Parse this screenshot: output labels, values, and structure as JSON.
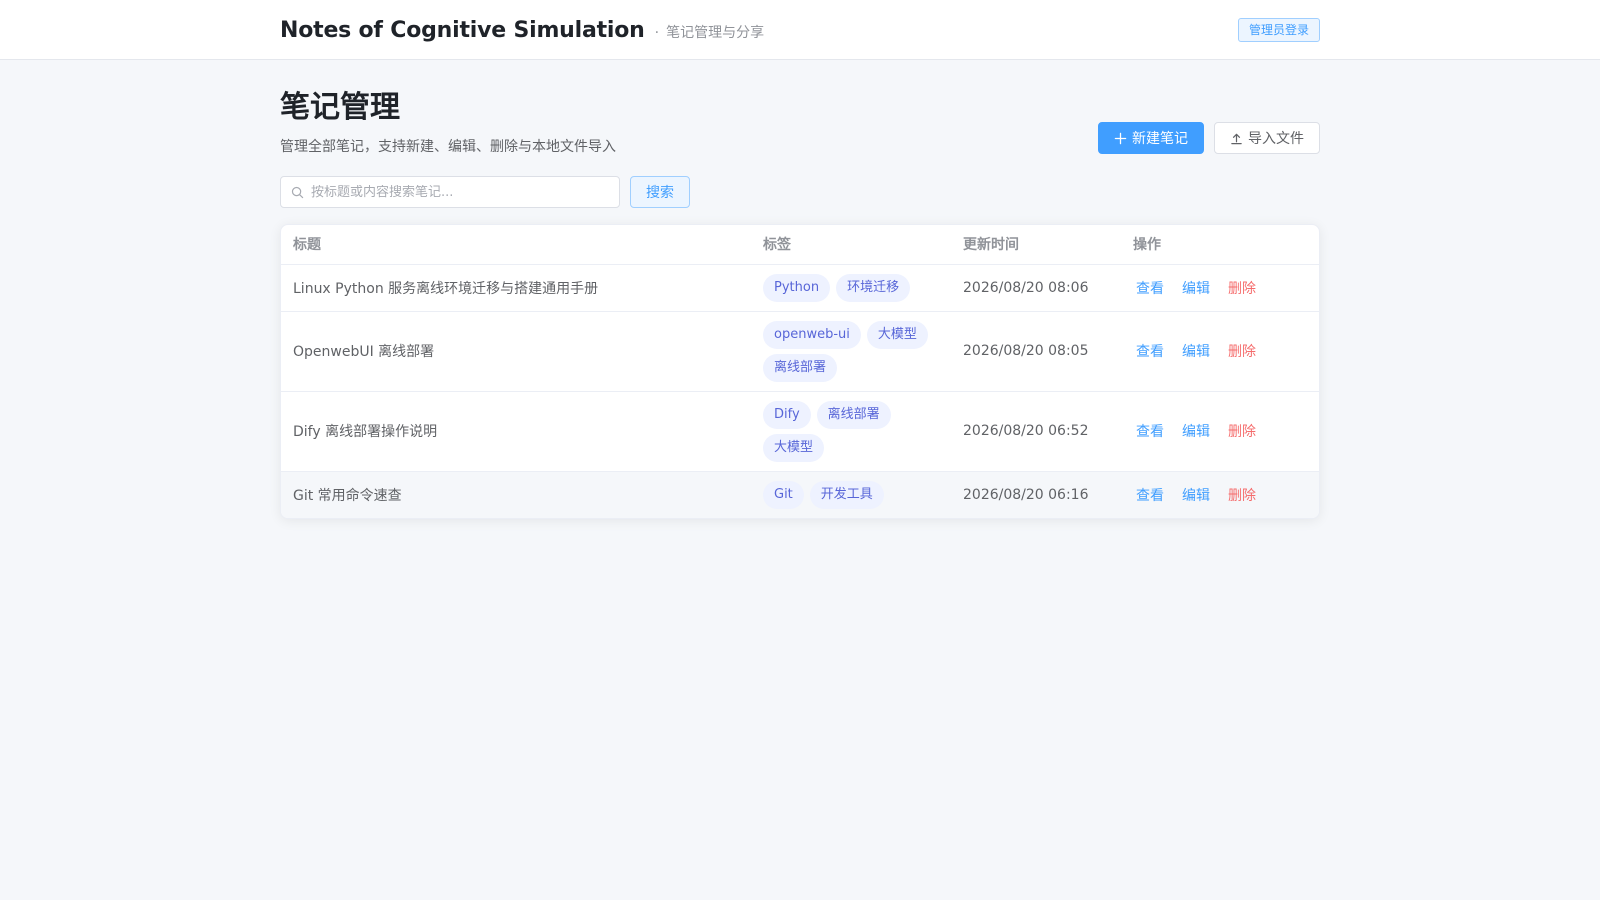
{
  "header": {
    "brand_title": "Notes of Cognitive Simulation",
    "separator": "·",
    "brand_subtitle": "笔记管理与分享",
    "admin_login_label": "管理员登录"
  },
  "page": {
    "title": "笔记管理",
    "description": "管理全部笔记，支持新建、编辑、删除与本地文件导入",
    "new_note_label": "新建笔记",
    "import_label": "导入文件"
  },
  "search": {
    "placeholder": "按标题或内容搜索笔记...",
    "value": "",
    "button_label": "搜索"
  },
  "table": {
    "columns": [
      "标题",
      "标签",
      "更新时间",
      "操作"
    ],
    "rows": [
      {
        "title": "Linux Python 服务离线环境迁移与搭建通用手册",
        "tags": [
          "Python",
          "环境迁移"
        ],
        "updated": "2026/08/20 08:06"
      },
      {
        "title": "OpenwebUI 离线部署",
        "tags": [
          "openweb-ui",
          "大模型",
          "离线部署"
        ],
        "updated": "2026/08/20 08:05"
      },
      {
        "title": "Dify 离线部署操作说明",
        "tags": [
          "Dify",
          "离线部署",
          "大模型"
        ],
        "updated": "2026/08/20 06:52"
      },
      {
        "title": "Git 常用命令速查",
        "tags": [
          "Git",
          "开发工具"
        ],
        "updated": "2026/08/20 06:16"
      }
    ],
    "actions": {
      "view": "查看",
      "edit": "编辑",
      "delete": "删除"
    }
  },
  "colors": {
    "primary": "#409eff",
    "danger": "#f56c6c",
    "tag_bg": "#eef2ff",
    "tag_text": "#5866d8",
    "page_bg": "#f5f7fa"
  },
  "icons": {
    "new_note": "plus-icon",
    "import": "upload-icon",
    "search": "search-icon"
  }
}
